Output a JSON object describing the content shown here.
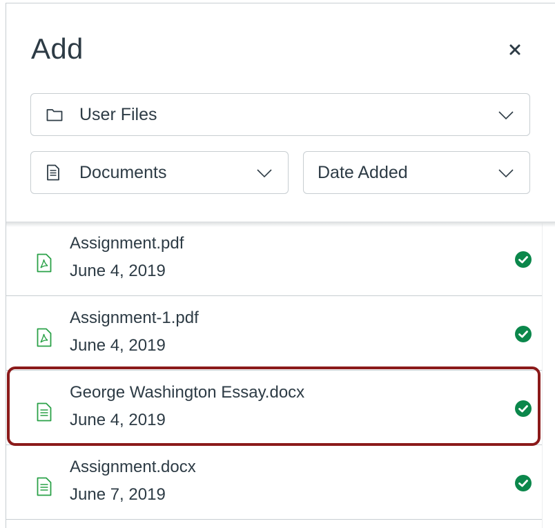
{
  "dialog": {
    "title": "Add",
    "close_glyph": "×"
  },
  "filters": {
    "folder": {
      "label": "User Files",
      "icon": "folder-icon"
    },
    "content_type": {
      "label": "Documents",
      "icon": "document-icon"
    },
    "sort": {
      "label": "Date Added"
    }
  },
  "files": [
    {
      "name": "Assignment.pdf",
      "date": "June 4, 2019",
      "type": "pdf",
      "status": "uploaded"
    },
    {
      "name": "Assignment-1.pdf",
      "date": "June 4, 2019",
      "type": "pdf",
      "status": "uploaded"
    },
    {
      "name": "George Washington Essay.docx",
      "date": "June 4, 2019",
      "type": "docx",
      "status": "uploaded",
      "highlighted": true
    },
    {
      "name": "Assignment.docx",
      "date": "June 7, 2019",
      "type": "docx",
      "status": "uploaded"
    }
  ],
  "colors": {
    "text": "#2d3b45",
    "border": "#c7cdd1",
    "file_icon": "#2aa147",
    "check": "#0b874b",
    "highlight": "#8b1a1a"
  }
}
